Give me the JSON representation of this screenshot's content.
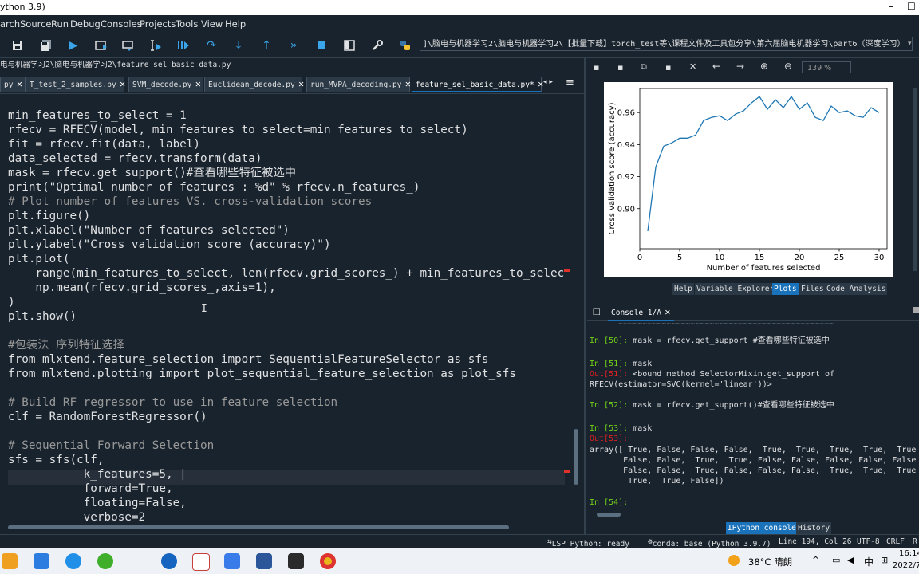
{
  "window": {
    "title": "ython 3.9)",
    "controls": [
      "–",
      "☐"
    ]
  },
  "menu": [
    "arch",
    "Source",
    "Run",
    "Debug",
    "Consoles",
    "Projects",
    "Tools",
    "View",
    "Help"
  ],
  "toolbar": {
    "path": "]\\脑电与机器学习2\\脑电与机器学习2\\【批量下载】torch_test等\\课程文件及工具包分享\\第六届脑电机器学习\\part6（深度学习）"
  },
  "editor": {
    "file_path": "电与机器学习2\\脑电与机器学习2\\feature_sel_basic_data.py",
    "tabs": [
      {
        "label": "py",
        "active": false
      },
      {
        "label": "T_test_2_samples.py",
        "active": false
      },
      {
        "label": "SVM_decode.py",
        "active": false
      },
      {
        "label": "Euclidean_decode.py",
        "active": false
      },
      {
        "label": "run_MVPA_decoding.py",
        "active": false
      },
      {
        "label": "feature_sel_basic_data.py*",
        "active": true
      }
    ],
    "code": [
      "min_features_to_select = 1",
      "rfecv = RFECV(model, min_features_to_select=min_features_to_select)",
      "fit = rfecv.fit(data, label)",
      "data_selected = rfecv.transform(data)",
      "mask = rfecv.get_support()#查看哪些特征被选中",
      "print(\"Optimal number of features : %d\" % rfecv.n_features_)",
      "# Plot number of features VS. cross-validation scores",
      "plt.figure()",
      "plt.xlabel(\"Number of features selected\")",
      "plt.ylabel(\"Cross validation score (accuracy)\")",
      "plt.plot(",
      "    range(min_features_to_select, len(rfecv.grid_scores_) + min_features_to_selec",
      "    np.mean(rfecv.grid_scores_,axis=1),",
      ")",
      "plt.show()",
      "",
      "#包装法 序列特征选择",
      "from mlxtend.feature_selection import SequentialFeatureSelector as sfs",
      "from mlxtend.plotting import plot_sequential_feature_selection as plot_sfs",
      "",
      "# Build RF regressor to use in feature selection",
      "clf = RandomForestRegressor()",
      "",
      "# Sequential Forward Selection",
      "sfs = sfs(clf,",
      "           k_features=5, |",
      "           forward=True,",
      "           floating=False,",
      "           verbose=2"
    ]
  },
  "plots": {
    "zoom": "139 %",
    "chart_data": {
      "type": "line",
      "xlabel": "Number of features selected",
      "ylabel": "Cross validation score (accuracy)",
      "xlim": [
        0,
        31
      ],
      "ylim": [
        0.875,
        0.975
      ],
      "xticks": [
        "0",
        "5",
        "10",
        "15",
        "20",
        "25",
        "30"
      ],
      "yticks": [
        "0.90",
        "0.92",
        "0.94",
        "0.96"
      ],
      "series": [
        {
          "x": [
            1,
            2,
            3,
            4,
            5,
            6,
            7,
            8,
            9,
            10,
            11,
            12,
            13,
            14,
            15,
            16,
            17,
            18,
            19,
            20,
            21,
            22,
            23,
            24,
            25,
            26,
            27,
            28,
            29,
            30
          ],
          "values": [
            0.886,
            0.926,
            0.939,
            0.941,
            0.944,
            0.944,
            0.946,
            0.955,
            0.957,
            0.958,
            0.955,
            0.959,
            0.961,
            0.966,
            0.97,
            0.962,
            0.968,
            0.963,
            0.97,
            0.962,
            0.966,
            0.957,
            0.955,
            0.964,
            0.96,
            0.961,
            0.958,
            0.957,
            0.963,
            0.96
          ]
        }
      ],
      "grid": false,
      "line_color": "#1f77b4"
    },
    "pane_tabs": [
      "Help",
      "Variable Explorer",
      "Plots",
      "Files",
      "Code Analysis"
    ],
    "active_pane_tab": "Plots"
  },
  "console": {
    "tab_label": "Console 1/A",
    "lines": [
      {
        "kind": "in",
        "prompt": "In [50]:",
        "text": " mask = rfecv.get_support #查看哪些特征被选中"
      },
      {
        "kind": "blank"
      },
      {
        "kind": "in",
        "prompt": "In [51]:",
        "text": " mask"
      },
      {
        "kind": "out",
        "prompt": "Out[51]:",
        "text": " <bound method SelectorMixin.get_support of"
      },
      {
        "kind": "text",
        "text": "RFECV(estimator=SVC(kernel='linear'))>"
      },
      {
        "kind": "blank"
      },
      {
        "kind": "in",
        "prompt": "In [52]:",
        "text": " mask = rfecv.get_support()#查看哪些特征被选中"
      },
      {
        "kind": "blank"
      },
      {
        "kind": "in",
        "prompt": "In [53]:",
        "text": " mask"
      },
      {
        "kind": "out",
        "prompt": "Out[53]:",
        "text": ""
      },
      {
        "kind": "text",
        "text": "array([ True, False, False, False,  True,  True,  True,  True,  True,"
      },
      {
        "kind": "text",
        "text": "       False, False,  True,  True, False, False, False, False, False,"
      },
      {
        "kind": "text",
        "text": "       False, False,  True, False, False, False,  True,  True,  True,"
      },
      {
        "kind": "text",
        "text": "        True,  True, False])"
      },
      {
        "kind": "blank"
      },
      {
        "kind": "in",
        "prompt": "In [54]:",
        "text": ""
      }
    ],
    "bottom_tabs": [
      "IPython console",
      "History"
    ],
    "active_bottom_tab": "IPython console"
  },
  "status": {
    "lsp": "LSP Python: ready",
    "conda": "conda: base (Python 3.9.7)",
    "position": "Line 194, Col 26",
    "encoding": "UTF-8",
    "eol": "CRLF",
    "perm": "R"
  },
  "taskbar": {
    "weather": "38°C 晴朗",
    "ime": "中",
    "time": "16:14",
    "date": "2022/7"
  }
}
